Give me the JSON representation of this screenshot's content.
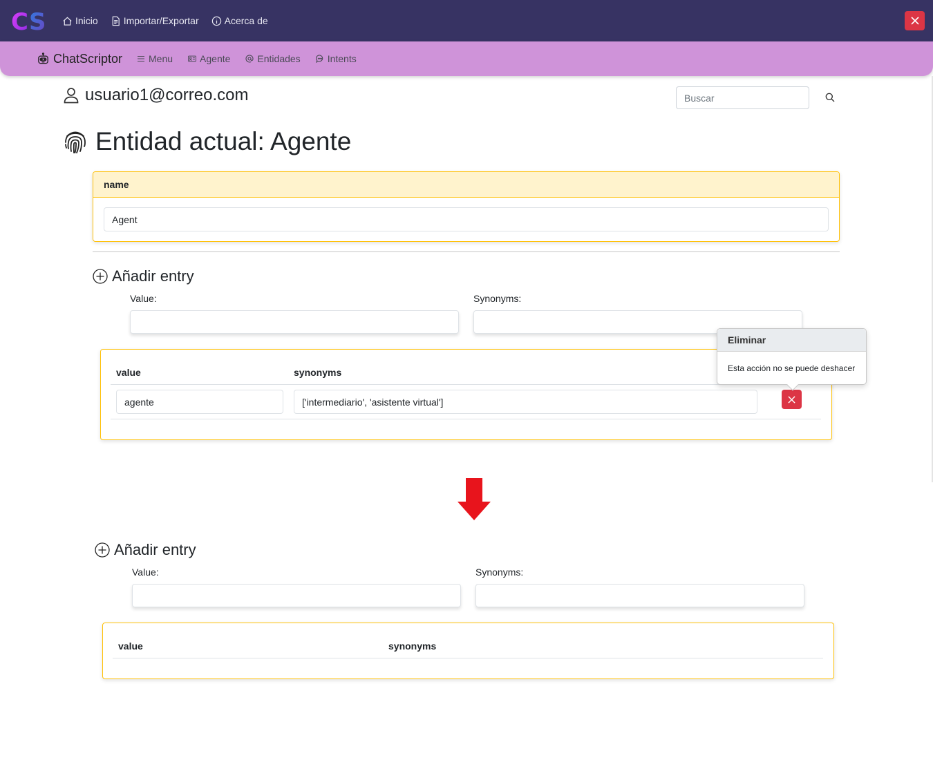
{
  "app": {
    "logo_text": "CS",
    "brand": "ChatScriptor"
  },
  "topnav": [
    {
      "label": "Inicio",
      "icon": "house-icon"
    },
    {
      "label": "Importar/Exportar",
      "icon": "file-icon"
    },
    {
      "label": "Acerca de",
      "icon": "info-circle-icon"
    }
  ],
  "secnav": [
    {
      "label": "Menu",
      "icon": "list-icon"
    },
    {
      "label": "Agente",
      "icon": "person-card-icon"
    },
    {
      "label": "Entidades",
      "icon": "at-icon"
    },
    {
      "label": "Intents",
      "icon": "chat-dots-icon"
    }
  ],
  "user": {
    "email": "usuario1@correo.com"
  },
  "search": {
    "placeholder": "Buscar"
  },
  "page": {
    "title": "Entidad actual: Agente"
  },
  "name_card": {
    "header": "name",
    "value": "Agent"
  },
  "entry_form": {
    "heading": "Añadir entry",
    "value_label": "Value:",
    "synonyms_label": "Synonyms:",
    "value_input": "",
    "synonyms_input": ""
  },
  "table_before": {
    "headers": [
      "value",
      "synonyms"
    ],
    "rows": [
      {
        "value": "agente",
        "synonyms": "['intermediario', 'asistente virtual']"
      }
    ]
  },
  "popover": {
    "title": "Eliminar",
    "body": "Esta acción no se puede deshacer"
  },
  "table_after": {
    "headers": [
      "value",
      "synonyms"
    ],
    "rows": []
  },
  "colors": {
    "topbar": "#373363",
    "secbar": "#cf93d9",
    "danger": "#dc3545",
    "card_border": "#ffc107",
    "card_header": "#fff3cd",
    "arrow": "#e8141c"
  }
}
